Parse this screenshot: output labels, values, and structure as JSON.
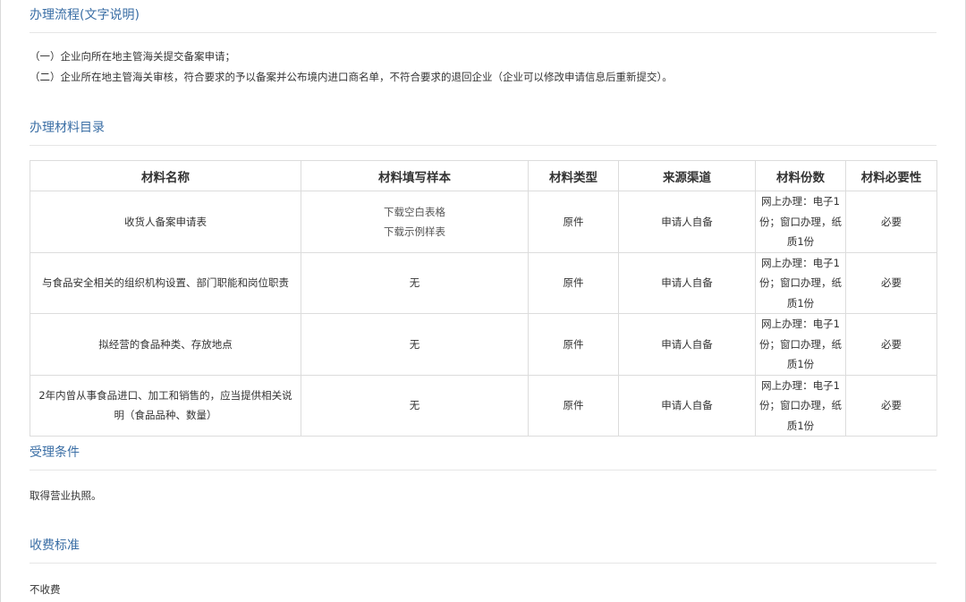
{
  "sections": {
    "process_title": "办理流程(文字说明)",
    "process_steps": [
      "（一）企业向所在地主管海关提交备案申请；",
      "（二）企业所在地主管海关审核，符合要求的予以备案并公布境内进口商名单，不符合要求的退回企业（企业可以修改申请信息后重新提交）。"
    ],
    "materials_title": "办理材料目录",
    "conditions_title": "受理条件",
    "conditions_text": "取得营业执照。",
    "fee_title": "收费标准",
    "fee_text": "不收费"
  },
  "table": {
    "headers": [
      "材料名称",
      "材料填写样本",
      "材料类型",
      "来源渠道",
      "材料份数",
      "材料必要性"
    ],
    "rows": [
      {
        "name": "收货人备案申请表",
        "sample": "",
        "sample_links": [
          "下载空白表格",
          "下载示例样表"
        ],
        "type": "原件",
        "source": "申请人自备",
        "copies": "网上办理：电子1份；窗口办理，纸质1份",
        "necessity": "必要"
      },
      {
        "name": "与食品安全相关的组织机构设置、部门职能和岗位职责",
        "sample": "无",
        "sample_links": [],
        "type": "原件",
        "source": "申请人自备",
        "copies": "网上办理：电子1份；窗口办理，纸质1份",
        "necessity": "必要"
      },
      {
        "name": "拟经营的食品种类、存放地点",
        "sample": "无",
        "sample_links": [],
        "type": "原件",
        "source": "申请人自备",
        "copies": "网上办理：电子1份；窗口办理，纸质1份",
        "necessity": "必要"
      },
      {
        "name": "2年内曾从事食品进口、加工和销售的，应当提供相关说明（食品品种、数量）",
        "sample": "无",
        "sample_links": [],
        "type": "原件",
        "source": "申请人自备",
        "copies": "网上办理：电子1份；窗口办理，纸质1份",
        "necessity": "必要"
      }
    ]
  }
}
